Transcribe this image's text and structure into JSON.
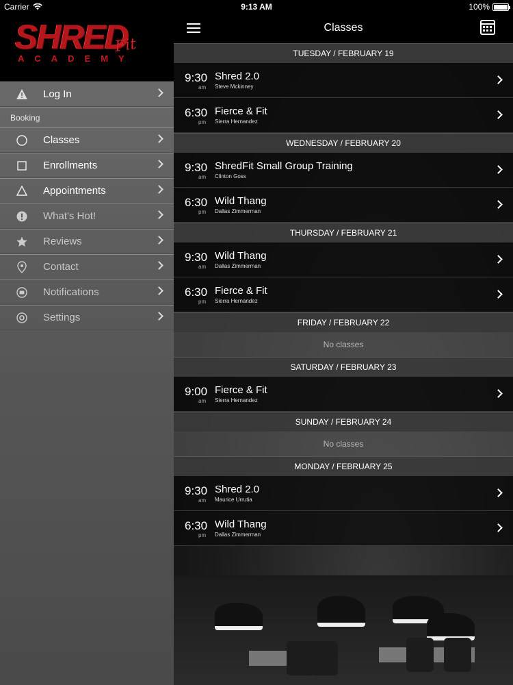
{
  "status_bar": {
    "carrier": "Carrier",
    "time": "9:13 AM",
    "battery": "100%"
  },
  "logo": {
    "line1": "SHRED",
    "script": "Fit",
    "line2": "ACADEMY"
  },
  "sidebar": {
    "section_label": "Booking",
    "login": {
      "label": "Log In",
      "icon": "warning-icon"
    },
    "items": [
      {
        "label": "Classes",
        "icon": "circle-icon"
      },
      {
        "label": "Enrollments",
        "icon": "square-icon"
      },
      {
        "label": "Appointments",
        "icon": "triangle-icon"
      },
      {
        "label": "What's Hot!",
        "icon": "exclamation-icon"
      },
      {
        "label": "Reviews",
        "icon": "star-icon"
      },
      {
        "label": "Contact",
        "icon": "location-pin-icon"
      },
      {
        "label": "Notifications",
        "icon": "speech-bubble-icon"
      },
      {
        "label": "Settings",
        "icon": "gear-icon"
      }
    ]
  },
  "navbar": {
    "title": "Classes",
    "menu_icon": "hamburger-icon",
    "calendar_icon": "calendar-icon"
  },
  "schedule": {
    "no_classes_text": "No classes",
    "days": [
      {
        "header": "TUESDAY / FEBRUARY 19",
        "classes": [
          {
            "time": "9:30",
            "ampm": "am",
            "name": "Shred 2.0",
            "instructor": "Steve Mckinney"
          },
          {
            "time": "6:30",
            "ampm": "pm",
            "name": "Fierce & Fit",
            "instructor": "Sierra Hernandez"
          }
        ]
      },
      {
        "header": "WEDNESDAY / FEBRUARY 20",
        "classes": [
          {
            "time": "9:30",
            "ampm": "am",
            "name": "ShredFit Small Group Training",
            "instructor": "Clinton Goss"
          },
          {
            "time": "6:30",
            "ampm": "pm",
            "name": "Wild Thang",
            "instructor": "Dallas Zimmerman"
          }
        ]
      },
      {
        "header": "THURSDAY / FEBRUARY 21",
        "classes": [
          {
            "time": "9:30",
            "ampm": "am",
            "name": "Wild Thang",
            "instructor": "Dallas Zimmerman"
          },
          {
            "time": "6:30",
            "ampm": "pm",
            "name": "Fierce & Fit",
            "instructor": "Sierra Hernandez"
          }
        ]
      },
      {
        "header": "FRIDAY / FEBRUARY 22",
        "classes": []
      },
      {
        "header": "SATURDAY / FEBRUARY 23",
        "classes": [
          {
            "time": "9:00",
            "ampm": "am",
            "name": "Fierce & Fit",
            "instructor": "Sierra Hernandez"
          }
        ]
      },
      {
        "header": "SUNDAY / FEBRUARY 24",
        "classes": []
      },
      {
        "header": "MONDAY / FEBRUARY 25",
        "classes": [
          {
            "time": "9:30",
            "ampm": "am",
            "name": "Shred 2.0",
            "instructor": "Maurice Urrutia"
          },
          {
            "time": "6:30",
            "ampm": "pm",
            "name": "Wild Thang",
            "instructor": "Dallas Zimmerman"
          }
        ]
      }
    ]
  },
  "colors": {
    "brand_red": "#b3161b",
    "sidebar_bg": "#6e6e6e",
    "header_bg": "#3c3c3c"
  }
}
